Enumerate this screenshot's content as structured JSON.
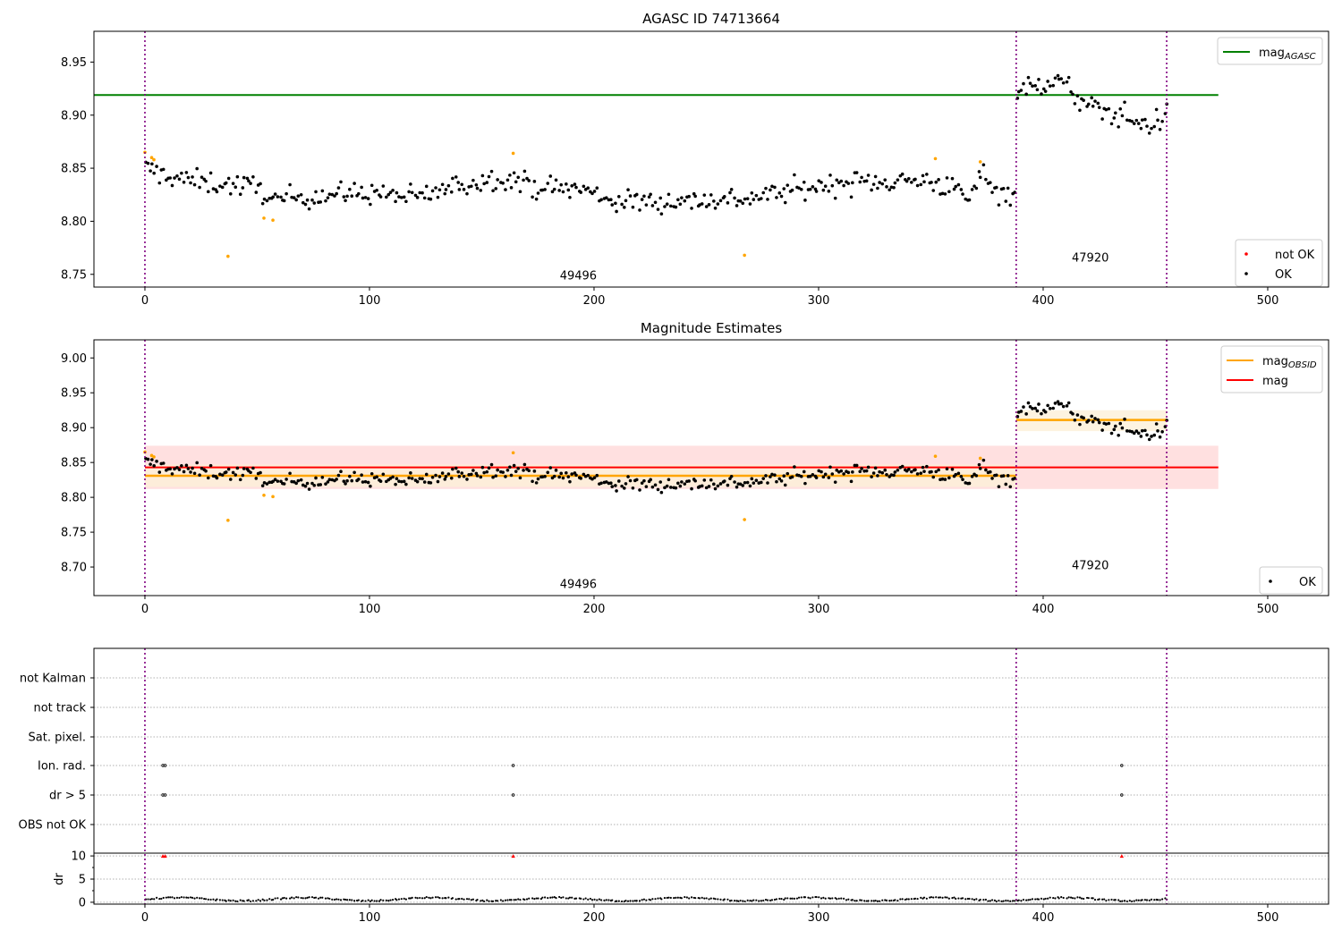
{
  "chart_data": [
    {
      "type": "scatter",
      "title": "AGASC ID 74713664",
      "xlim": [
        -22.7,
        527.1
      ],
      "ylim": [
        8.738,
        8.979
      ],
      "xticks": [
        0,
        100,
        200,
        300,
        400,
        500
      ],
      "yticks": [
        8.75,
        8.8,
        8.85,
        8.9,
        8.95
      ],
      "ytick_labels": [
        "8.75",
        "8.80",
        "8.85",
        "8.90",
        "8.95"
      ],
      "obsid_boundaries": [
        0,
        388,
        455
      ],
      "obsid_labels": [
        {
          "text": "49496",
          "x": 193,
          "y": 8.745
        },
        {
          "text": "47920",
          "x": 421,
          "y": 8.762
        }
      ],
      "mag_agasc": {
        "value": 8.919,
        "x": [
          -22.7,
          478
        ],
        "color": "#008000"
      },
      "legend_upper": {
        "placement": "top-right",
        "entries": [
          {
            "label": "mag",
            "sub": "AGASC",
            "color": "#008000"
          }
        ]
      },
      "legend_lower": {
        "placement": "bottom-right",
        "entries": [
          {
            "label": "not OK",
            "color": "#ff0000"
          },
          {
            "label": "OK",
            "color": "#000000"
          }
        ]
      }
    },
    {
      "type": "scatter",
      "title": "Magnitude Estimates",
      "xlim": [
        -22.7,
        527.1
      ],
      "ylim": [
        8.659,
        9.026
      ],
      "xticks": [
        0,
        100,
        200,
        300,
        400,
        500
      ],
      "yticks": [
        8.7,
        8.75,
        8.8,
        8.85,
        8.9,
        8.95,
        9.0
      ],
      "ytick_labels": [
        "8.70",
        "8.75",
        "8.80",
        "8.85",
        "8.90",
        "8.95",
        "9.00"
      ],
      "obsid_labels": [
        {
          "text": "49496",
          "x": 193,
          "y": 8.67
        },
        {
          "text": "47920",
          "x": 421,
          "y": 8.697
        }
      ],
      "mag": {
        "value": 8.843,
        "band": [
          8.812,
          8.874
        ],
        "x": [
          0,
          478
        ],
        "color": "#ff0000"
      },
      "mag_obsid": [
        {
          "value": 8.831,
          "band": [
            8.815,
            8.847
          ],
          "x": [
            0,
            388
          ]
        },
        {
          "value": 8.911,
          "band": [
            8.895,
            8.925
          ],
          "x": [
            388,
            455
          ]
        }
      ],
      "legend_upper": {
        "placement": "top-right",
        "entries": [
          {
            "label": "mag",
            "sub": "OBSID",
            "color": "#ffa500"
          },
          {
            "label": "mag",
            "sub": "",
            "color": "#ff0000"
          }
        ]
      },
      "legend_lower": {
        "placement": "bottom-right",
        "entries": [
          {
            "label": "OK",
            "color": "#000000"
          }
        ]
      }
    },
    {
      "type": "scatter",
      "categories": [
        "not Kalman",
        "not track",
        "Sat. pixel.",
        "Ion. rad.",
        "dr > 5",
        "OBS not OK"
      ],
      "flags": {
        "Ion. rad.": [
          8,
          9,
          164,
          435
        ],
        "dr > 5": [
          8,
          9,
          164,
          435
        ]
      },
      "dr_ylabel": "dr",
      "dr_yticks": [
        0,
        5,
        10
      ],
      "dr_ytick_labels": [
        "0",
        "5",
        "10"
      ],
      "dr_ylim": [
        -0.4,
        10.6
      ],
      "dr_high_points": [
        8,
        9,
        164,
        435
      ],
      "dr_typical": 0.5,
      "xticks": [
        0,
        100,
        200,
        300,
        400,
        500
      ]
    }
  ],
  "series": {
    "segments": [
      {
        "obsid": "49496",
        "x": [
          0,
          388
        ],
        "trend": [
          [
            0,
            8.85
          ],
          [
            6,
            8.845
          ],
          [
            20,
            8.838
          ],
          [
            50,
            8.832
          ],
          [
            58,
            8.818
          ],
          [
            65,
            8.823
          ],
          [
            100,
            8.827
          ],
          [
            120,
            8.822
          ],
          [
            140,
            8.834
          ],
          [
            160,
            8.842
          ],
          [
            175,
            8.832
          ],
          [
            195,
            8.83
          ],
          [
            210,
            8.818
          ],
          [
            250,
            8.82
          ],
          [
            270,
            8.822
          ],
          [
            290,
            8.83
          ],
          [
            310,
            8.836
          ],
          [
            330,
            8.838
          ],
          [
            350,
            8.838
          ],
          [
            362,
            8.828
          ],
          [
            367,
            8.82
          ],
          [
            373,
            8.848
          ],
          [
            380,
            8.826
          ],
          [
            388,
            8.827
          ]
        ],
        "noise": 0.009
      },
      {
        "obsid": "47920",
        "x": [
          388,
          455
        ],
        "trend": [
          [
            388,
            8.924
          ],
          [
            395,
            8.925
          ],
          [
            405,
            8.935
          ],
          [
            412,
            8.922
          ],
          [
            420,
            8.907
          ],
          [
            435,
            8.9
          ],
          [
            445,
            8.89
          ],
          [
            455,
            8.898
          ]
        ],
        "noise": 0.01
      }
    ],
    "outliers": [
      [
        0,
        8.865
      ],
      [
        3,
        8.86
      ],
      [
        4,
        8.858
      ],
      [
        37,
        8.767
      ],
      [
        53,
        8.803
      ],
      [
        57,
        8.801
      ],
      [
        164,
        8.864
      ],
      [
        267,
        8.768
      ],
      [
        352,
        8.859
      ],
      [
        372,
        8.856
      ]
    ],
    "outlier_color": "#ffa500"
  },
  "colors": {
    "boundary": "#800080",
    "mag_obsid": "#ffa500",
    "band_obsid": "#fdf0d8",
    "band_mag": "#ffe0e0"
  }
}
